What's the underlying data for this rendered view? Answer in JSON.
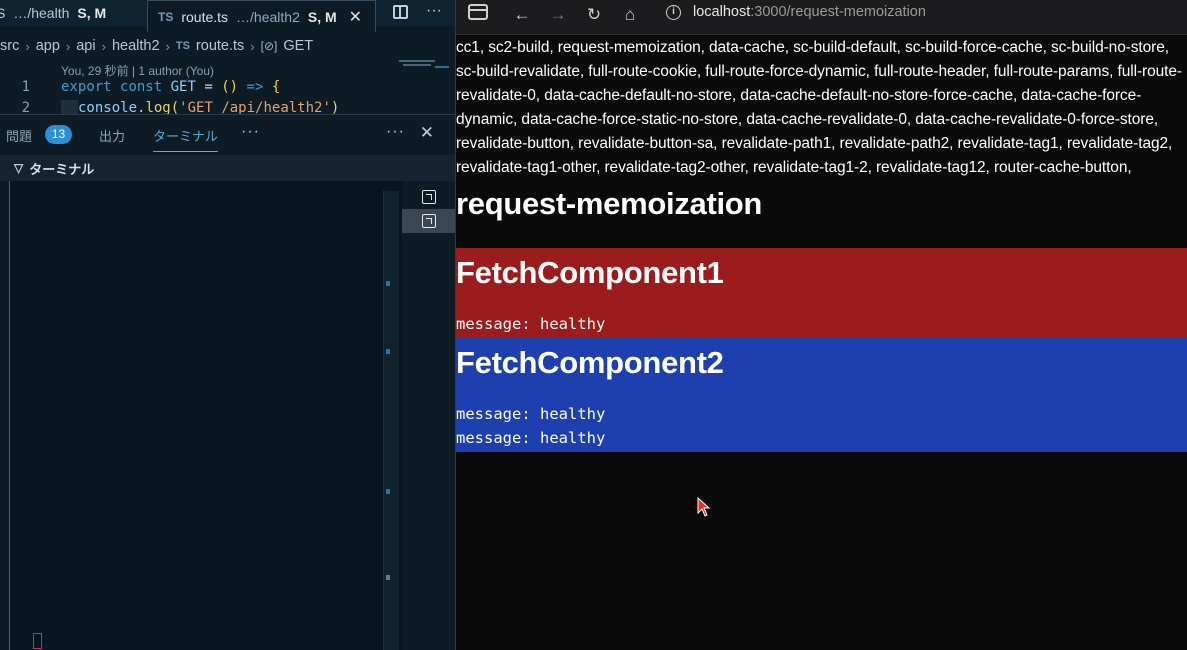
{
  "editor": {
    "tabs": [
      {
        "prefix": "S",
        "path": "…/health",
        "status": "S, M"
      },
      {
        "lang": "TS",
        "name": "route.ts",
        "path": "…/health2",
        "status": "S, M",
        "close": "✕"
      }
    ],
    "breadcrumb": [
      "src",
      "app",
      "api",
      "health2",
      "route.ts",
      "GET"
    ],
    "breadcrumb_ts": "TS",
    "blame": "You, 29 秒前 | 1 author (You)",
    "lines": [
      {
        "num": "1",
        "t1": "export",
        "t2": "const",
        "t3": "GET",
        "t4": "=",
        "t5": "()",
        "t6": "=>",
        "t7": "{"
      },
      {
        "num": "2",
        "t1": "console",
        "t2": ".log(",
        "t3": "'GET /api/health2'",
        "t4": ")"
      }
    ]
  },
  "panel": {
    "problems_label": "問題",
    "problems_count": "13",
    "output_label": "出力",
    "terminal_label": "ターミナル",
    "more": "···",
    "close": "✕",
    "terminal_header": "ターミナル"
  },
  "browser": {
    "url_host": "localhost",
    "url_rest": ":3000/request-memoization"
  },
  "page": {
    "links_text": "cc1, sc2-build, request-memoization, data-cache, sc-build-default, sc-build-force-cache, sc-build-no-store, sc-build-revalidate, full-route-cookie, full-route-force-dynamic, full-route-header, full-route-params, full-route-revalidate-0, data-cache-default-no-store, data-cache-default-no-store-force-cache, data-cache-force-dynamic, data-cache-force-static-no-store, data-cache-revalidate-0, data-cache-revalidate-0-force-store, revalidate-button, revalidate-button-sa, revalidate-path1, revalidate-path2, revalidate-tag1, revalidate-tag2, revalidate-tag1-other, revalidate-tag2-other, revalidate-tag1-2, revalidate-tag12, router-cache-button,",
    "heading": "request-memoization",
    "components": [
      {
        "title": "FetchComponent1",
        "messages": [
          "message: healthy"
        ],
        "color": "#9b1c1c"
      },
      {
        "title": "FetchComponent2",
        "messages": [
          "message: healthy",
          "message: healthy"
        ],
        "color": "#1e40af"
      }
    ]
  },
  "icons": [
    "split-editor-icon",
    "more-icon",
    "chevron-right-icon",
    "symbol-method-icon",
    "chevron-down-icon",
    "terminal-instance-icon",
    "sidebar-toggle-icon",
    "back-arrow-icon",
    "forward-arrow-icon",
    "reload-icon",
    "home-icon",
    "info-icon",
    "mouse-cursor-icon"
  ]
}
